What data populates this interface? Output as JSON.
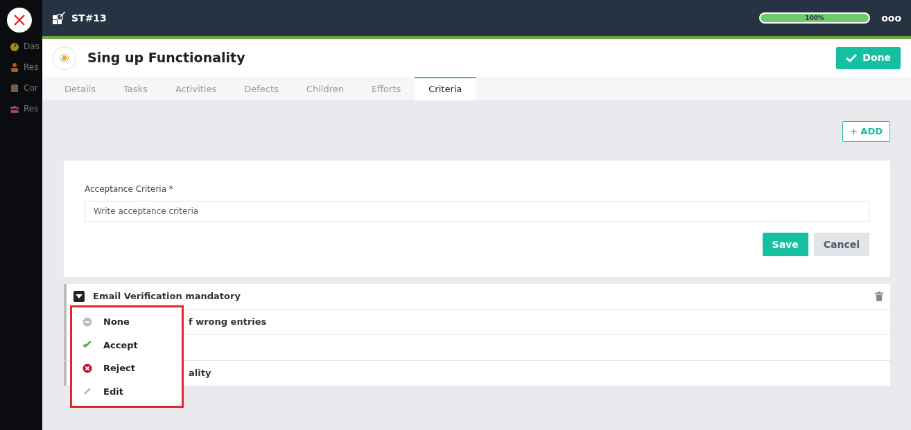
{
  "sidebar": {
    "items": [
      {
        "label": "Das"
      },
      {
        "label": "Res"
      },
      {
        "label": "Cor"
      },
      {
        "label": "Res"
      }
    ]
  },
  "header": {
    "title": "ST#13",
    "progress": {
      "level": 1.0,
      "reading": "100%"
    },
    "more": "ooo"
  },
  "story": {
    "title": "Sing up Functionality",
    "done_button": "Done"
  },
  "tabs": [
    {
      "label": "Details",
      "selected": false
    },
    {
      "label": "Tasks",
      "selected": false
    },
    {
      "label": "Activities",
      "selected": false
    },
    {
      "label": "Defects",
      "selected": false
    },
    {
      "label": "Children",
      "selected": false
    },
    {
      "label": "Efforts",
      "selected": false
    },
    {
      "label": "Criteria",
      "selected": true
    }
  ],
  "add_button": "+ ADD",
  "form": {
    "label": "Acceptance Criteria",
    "required": "*",
    "placeholder": "Write acceptance criteria",
    "save": "Save",
    "cancel": "Cancel"
  },
  "criteria": [
    {
      "text": "Email Verification mandatory",
      "menu_open": true
    },
    {
      "text": "f wrong entries",
      "menu_open": false
    },
    {
      "menu_open": false
    },
    {
      "text": "ality",
      "menu_open": false
    }
  ],
  "menu": [
    {
      "kind": "none",
      "label": "None"
    },
    {
      "kind": "accept",
      "label": "Accept"
    },
    {
      "kind": "reject",
      "label": "Reject"
    },
    {
      "kind": "edit",
      "label": "Edit"
    }
  ]
}
